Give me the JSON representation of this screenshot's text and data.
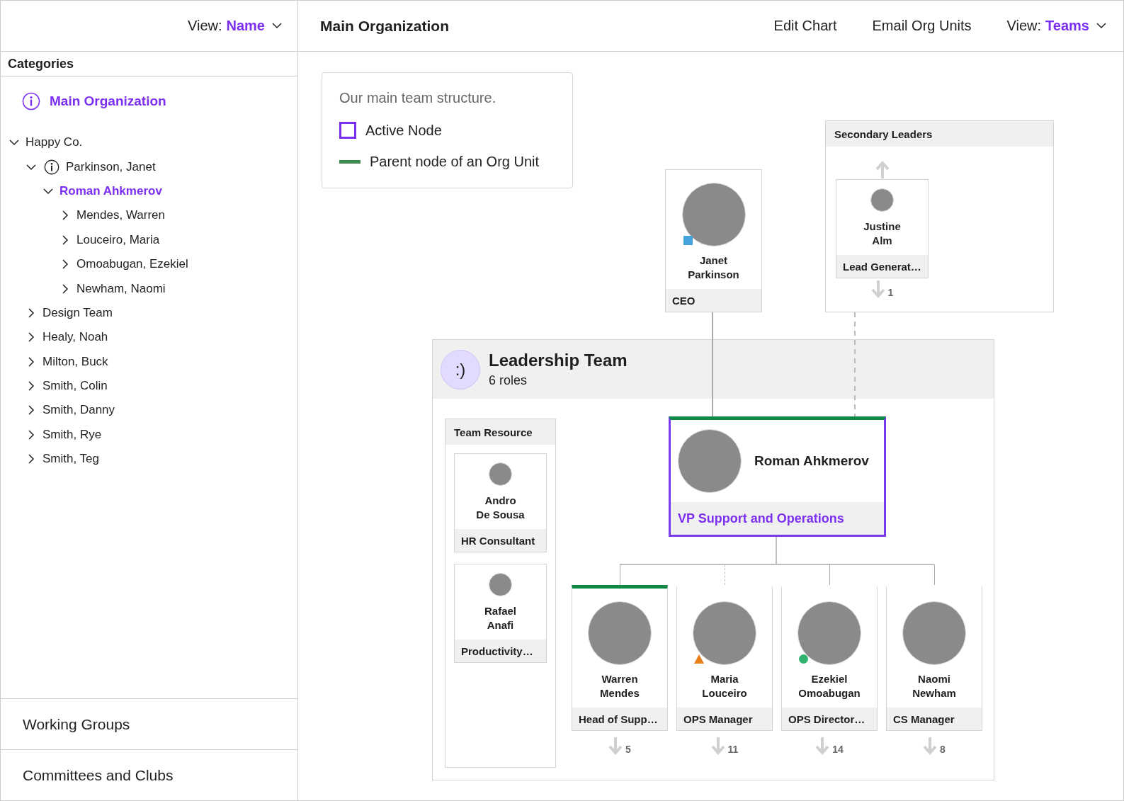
{
  "sidebar": {
    "view_label": "View:",
    "view_value": "Name",
    "categories_title": "Categories",
    "main_item": {
      "label": "Main Organization",
      "selected": true
    },
    "tree": [
      {
        "label": "Happy Co.",
        "expanded": true,
        "selected": false,
        "info_icon": false,
        "children": [
          {
            "label": "Parkinson, Janet",
            "expanded": true,
            "selected": false,
            "info_icon": true,
            "children": [
              {
                "label": "Roman Ahkmerov",
                "expanded": true,
                "selected": true,
                "info_icon": false,
                "children": [
                  {
                    "label": "Mendes, Warren",
                    "expanded": false,
                    "selected": false,
                    "info_icon": false
                  },
                  {
                    "label": "Louceiro, Maria",
                    "expanded": false,
                    "selected": false,
                    "info_icon": false
                  },
                  {
                    "label": "Omoabugan, Ezekiel",
                    "expanded": false,
                    "selected": false,
                    "info_icon": false
                  },
                  {
                    "label": "Newham, Naomi",
                    "expanded": false,
                    "selected": false,
                    "info_icon": false
                  }
                ]
              }
            ]
          },
          {
            "label": "Design Team",
            "expanded": false,
            "selected": false,
            "info_icon": false
          },
          {
            "label": "Healy, Noah",
            "expanded": false,
            "selected": false,
            "info_icon": false
          },
          {
            "label": "Milton, Buck",
            "expanded": false,
            "selected": false,
            "info_icon": false
          },
          {
            "label": "Smith, Colin",
            "expanded": false,
            "selected": false,
            "info_icon": false
          },
          {
            "label": "Smith, Danny",
            "expanded": false,
            "selected": false,
            "info_icon": false
          },
          {
            "label": "Smith, Rye",
            "expanded": false,
            "selected": false,
            "info_icon": false
          },
          {
            "label": "Smith, Teg",
            "expanded": false,
            "selected": false,
            "info_icon": false
          }
        ]
      }
    ],
    "sections": [
      "Working Groups",
      "Committees and Clubs"
    ]
  },
  "header": {
    "title": "Main Organization",
    "actions": [
      "Edit Chart",
      "Email Org Units"
    ],
    "view_label": "View:",
    "view_value": "Teams"
  },
  "legend": {
    "description": "Our main team structure.",
    "items": [
      {
        "kind": "active",
        "label": "Active Node"
      },
      {
        "kind": "parent",
        "label": "Parent node of an Org Unit"
      }
    ]
  },
  "top_node": {
    "name_lines": [
      "Janet",
      "Parkinson"
    ],
    "role": "CEO",
    "status": {
      "kind": "square",
      "color": "#44a3dd"
    }
  },
  "secondary": {
    "title": "Secondary Leaders",
    "nodes": [
      {
        "name_lines": [
          "Justine",
          "Alm"
        ],
        "role": "Lead Generat…",
        "count": "1"
      }
    ]
  },
  "team": {
    "icon": ":)",
    "title": "Leadership Team",
    "subtitle": "6 roles",
    "resource": {
      "title": "Team Resource",
      "members": [
        {
          "name_lines": [
            "Andro",
            "De Sousa"
          ],
          "role": "HR Consultant"
        },
        {
          "name_lines": [
            "Rafael",
            "Anafi"
          ],
          "role": "Productivity…"
        }
      ]
    },
    "lead": {
      "name": "Roman Ahkmerov",
      "role": "VP Support and Operations",
      "active": true,
      "org_unit_parent": true
    },
    "reports": [
      {
        "name_lines": [
          "Warren",
          "Mendes"
        ],
        "role": "Head of Supp…",
        "count": "5",
        "org_unit_parent": true,
        "dashed_link": false
      },
      {
        "name_lines": [
          "Maria",
          "Louceiro"
        ],
        "role": "OPS Manager",
        "count": "11",
        "org_unit_parent": false,
        "dashed_link": true,
        "status": {
          "kind": "triangle",
          "color": "#e8801a"
        }
      },
      {
        "name_lines": [
          "Ezekiel",
          "Omoabugan"
        ],
        "role": "OPS Director…",
        "count": "14",
        "org_unit_parent": false,
        "dashed_link": false,
        "status": {
          "kind": "circle",
          "color": "#2fb36f"
        }
      },
      {
        "name_lines": [
          "Naomi",
          "Newham"
        ],
        "role": "CS Manager",
        "count": "8",
        "org_unit_parent": false,
        "dashed_link": false
      }
    ]
  }
}
